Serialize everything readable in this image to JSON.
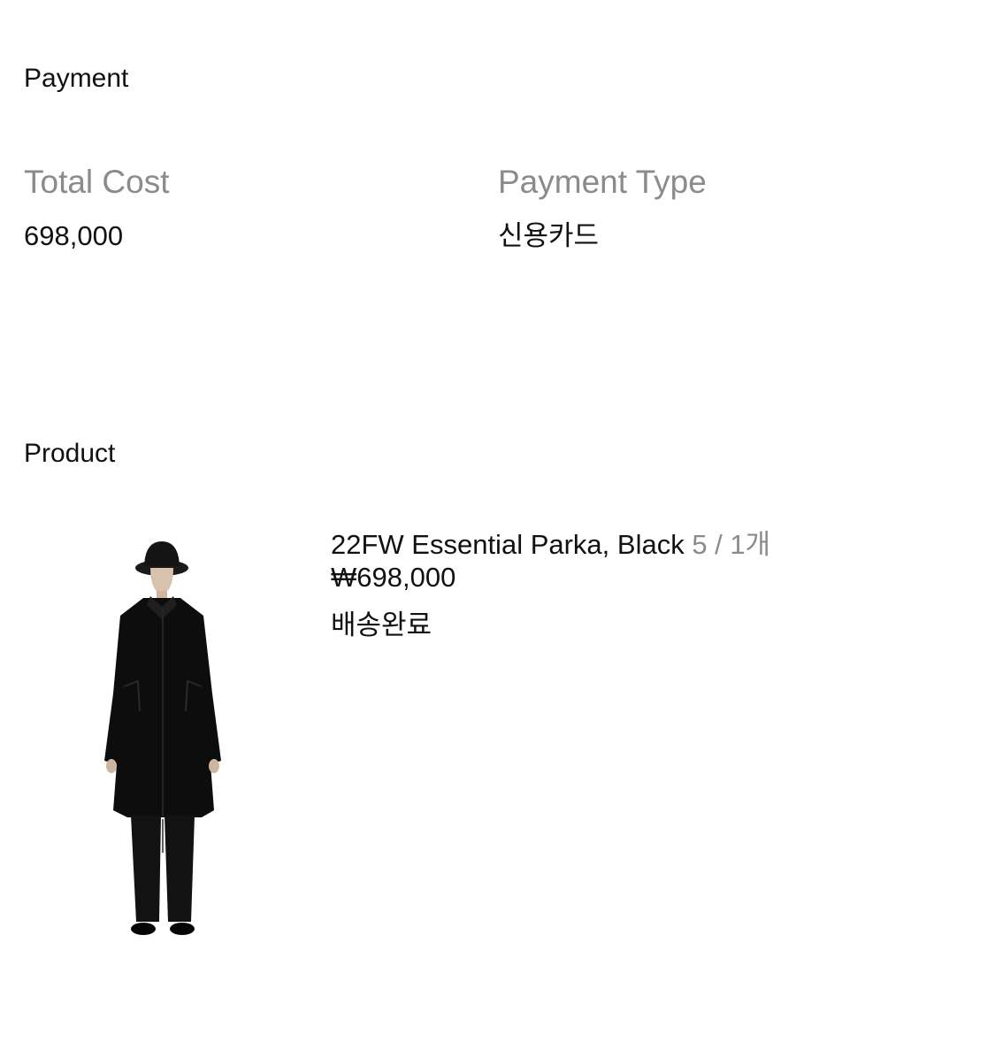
{
  "payment": {
    "title": "Payment",
    "total_cost_label": "Total Cost",
    "total_cost_value": "698,000",
    "payment_type_label": "Payment Type",
    "payment_type_value": "신용카드"
  },
  "product": {
    "title": "Product",
    "items": [
      {
        "name": "22FW Essential Parka, Black",
        "option": "5 / 1개",
        "price": "₩698,000",
        "status": "배송완료",
        "image_icon": "person-wearing-black-parka-image"
      }
    ]
  },
  "colors": {
    "text": "#111111",
    "muted": "#8c8a8a",
    "background": "#ffffff"
  }
}
